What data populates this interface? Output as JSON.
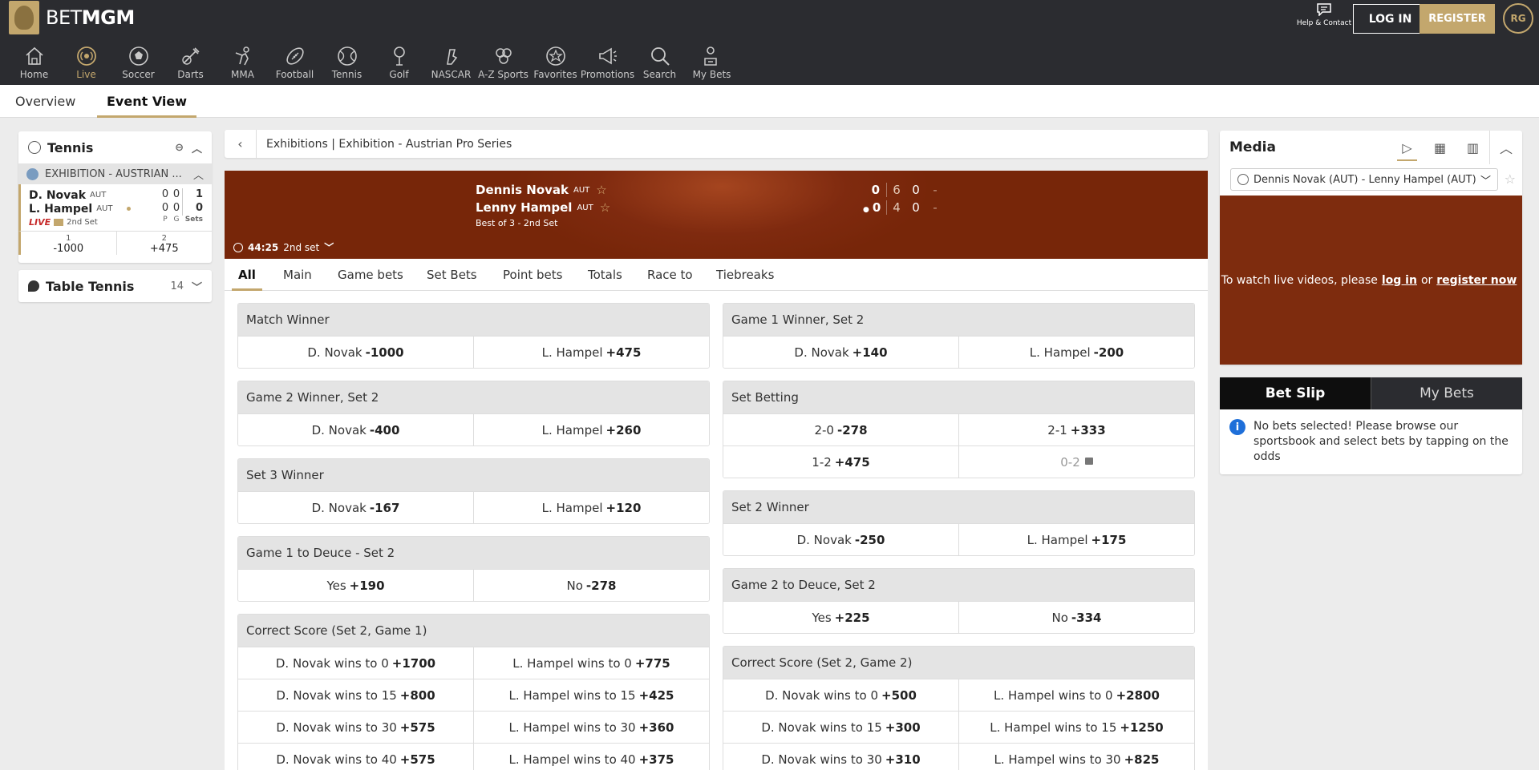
{
  "header": {
    "brand_bet": "BET",
    "brand_mgm": "MGM",
    "help_label": "Help & Contact",
    "login_label": "LOG IN",
    "register_label": "REGISTER",
    "rg_label": "RG"
  },
  "nav": [
    {
      "label": "Home",
      "icon": "home-icon"
    },
    {
      "label": "Live",
      "icon": "live-icon"
    },
    {
      "label": "Soccer",
      "icon": "soccer-icon"
    },
    {
      "label": "Darts",
      "icon": "darts-icon"
    },
    {
      "label": "MMA",
      "icon": "mma-icon"
    },
    {
      "label": "Football",
      "icon": "football-icon"
    },
    {
      "label": "Tennis",
      "icon": "tennis-icon"
    },
    {
      "label": "Golf",
      "icon": "golf-icon"
    },
    {
      "label": "NASCAR",
      "icon": "nascar-icon"
    },
    {
      "label": "A-Z Sports",
      "icon": "az-sports-icon"
    },
    {
      "label": "Favorites",
      "icon": "favorites-icon"
    },
    {
      "label": "Promotions",
      "icon": "promotions-icon"
    },
    {
      "label": "Search",
      "icon": "search-icon"
    },
    {
      "label": "My Bets",
      "icon": "my-bets-icon"
    }
  ],
  "subtabs": {
    "overview": "Overview",
    "event_view": "Event View"
  },
  "sidebar": {
    "sport": "Tennis",
    "league": "EXHIBITION - AUSTRIAN ...",
    "event": {
      "p1": "D. Novak",
      "p1_cc": "AUT",
      "p1_p": "0",
      "p1_g": "0",
      "p1_sets": "1",
      "p2": "L. Hampel",
      "p2_cc": "AUT",
      "p2_p": "0",
      "p2_g": "0",
      "p2_sets": "0",
      "live": "LIVE",
      "set_label": "2nd Set",
      "col_p": "P",
      "col_g": "G",
      "col_sets": "Sets",
      "odds": [
        {
          "n": "1",
          "v": "-1000"
        },
        {
          "n": "2",
          "v": "+475"
        }
      ]
    },
    "other_sport": "Table Tennis",
    "other_count": "14"
  },
  "breadcrumb": "Exhibitions | Exhibition - Austrian Pro Series",
  "scoreboard": {
    "p1": "Dennis Novak",
    "p1_cc": "AUT",
    "p2": "Lenny Hampel",
    "p2_cc": "AUT",
    "format": "Best of 3 - 2nd Set",
    "p1_points": "0",
    "p1_s1": "6",
    "p1_s2": "0",
    "p1_s3": "-",
    "p2_points": "0",
    "p2_s1": "4",
    "p2_s2": "0",
    "p2_s3": "-",
    "time": "44:25",
    "period": "2nd set"
  },
  "market_tabs": [
    "All",
    "Main",
    "Game bets",
    "Set Bets",
    "Point bets",
    "Totals",
    "Race to",
    "Tiebreaks"
  ],
  "markets_left": [
    {
      "title": "Match Winner",
      "rows": [
        [
          {
            "l": "D. Novak",
            "o": "-1000"
          },
          {
            "l": "L. Hampel",
            "o": "+475"
          }
        ]
      ]
    },
    {
      "title": "Game 2 Winner, Set 2",
      "rows": [
        [
          {
            "l": "D. Novak",
            "o": "-400"
          },
          {
            "l": "L. Hampel",
            "o": "+260"
          }
        ]
      ]
    },
    {
      "title": "Set 3 Winner",
      "rows": [
        [
          {
            "l": "D. Novak",
            "o": "-167"
          },
          {
            "l": "L. Hampel",
            "o": "+120"
          }
        ]
      ]
    },
    {
      "title": "Game 1 to Deuce - Set 2",
      "rows": [
        [
          {
            "l": "Yes",
            "o": "+190"
          },
          {
            "l": "No",
            "o": "-278"
          }
        ]
      ]
    },
    {
      "title": "Correct Score (Set 2, Game 1)",
      "rows": [
        [
          {
            "l": "D. Novak wins to 0",
            "o": "+1700"
          },
          {
            "l": "L. Hampel wins to 0",
            "o": "+775"
          }
        ],
        [
          {
            "l": "D. Novak wins to 15",
            "o": "+800"
          },
          {
            "l": "L. Hampel wins to 15",
            "o": "+425"
          }
        ],
        [
          {
            "l": "D. Novak wins to 30",
            "o": "+575"
          },
          {
            "l": "L. Hampel wins to 30",
            "o": "+360"
          }
        ],
        [
          {
            "l": "D. Novak wins to 40",
            "o": "+575"
          },
          {
            "l": "L. Hampel wins to 40",
            "o": "+375"
          }
        ]
      ]
    }
  ],
  "markets_right": [
    {
      "title": "Game 1 Winner, Set 2",
      "rows": [
        [
          {
            "l": "D. Novak",
            "o": "+140"
          },
          {
            "l": "L. Hampel",
            "o": "-200"
          }
        ]
      ]
    },
    {
      "title": "Set Betting",
      "rows": [
        [
          {
            "l": "2-0",
            "o": "-278"
          },
          {
            "l": "2-1",
            "o": "+333"
          }
        ],
        [
          {
            "l": "1-2",
            "o": "+475"
          },
          {
            "l": "0-2",
            "o": "",
            "locked": true
          }
        ]
      ]
    },
    {
      "title": "Set 2 Winner",
      "rows": [
        [
          {
            "l": "D. Novak",
            "o": "-250"
          },
          {
            "l": "L. Hampel",
            "o": "+175"
          }
        ]
      ]
    },
    {
      "title": "Game 2 to Deuce, Set 2",
      "rows": [
        [
          {
            "l": "Yes",
            "o": "+225"
          },
          {
            "l": "No",
            "o": "-334"
          }
        ]
      ]
    },
    {
      "title": "Correct Score (Set 2, Game 2)",
      "rows": [
        [
          {
            "l": "D. Novak wins to 0",
            "o": "+500"
          },
          {
            "l": "L. Hampel wins to 0",
            "o": "+2800"
          }
        ],
        [
          {
            "l": "D. Novak wins to 15",
            "o": "+300"
          },
          {
            "l": "L. Hampel wins to 15",
            "o": "+1250"
          }
        ],
        [
          {
            "l": "D. Novak wins to 30",
            "o": "+310"
          },
          {
            "l": "L. Hampel wins to 30",
            "o": "+825"
          }
        ]
      ]
    }
  ],
  "media": {
    "title": "Media",
    "select": "Dennis Novak (AUT) - Lenny Hampel (AUT)",
    "msg_pre": "To watch live videos, please",
    "msg_login": "log in",
    "msg_or": "or",
    "msg_register": "register now"
  },
  "betslip": {
    "tab_slip": "Bet Slip",
    "tab_mybets": "My Bets",
    "message": "No bets selected! Please browse our sportsbook and select bets by tapping on the odds"
  },
  "colors": {
    "brand_gold": "#c3a76d",
    "header_bg": "#2b2c30",
    "scoreboard_bg": "#7f2a0f"
  }
}
